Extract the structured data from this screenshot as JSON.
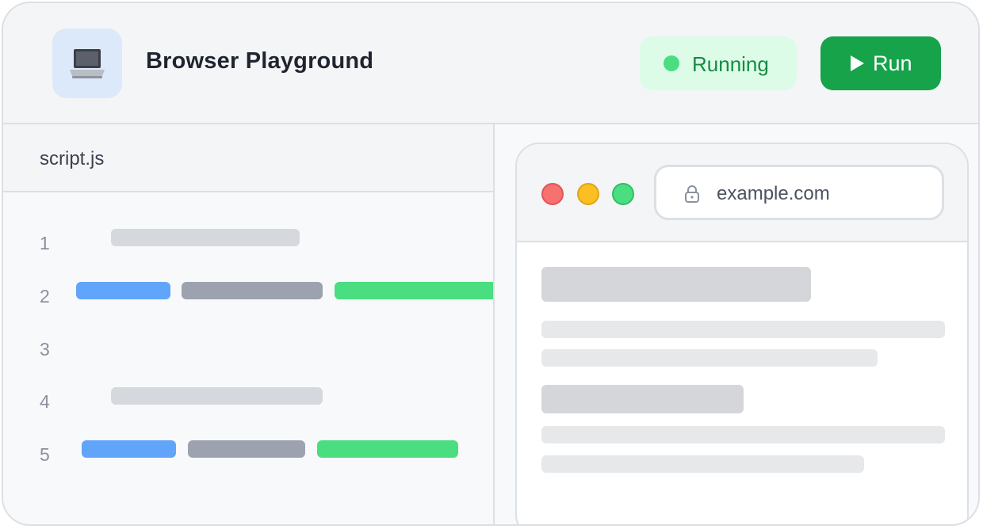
{
  "header": {
    "app_icon": "laptop-icon",
    "title": "Browser Playground",
    "status": {
      "label": "Running",
      "color": "#4ade80"
    },
    "run_button": {
      "icon": "play-icon",
      "label": "Run",
      "color": "#16a34a"
    }
  },
  "editor": {
    "tab": "script.js",
    "line_numbers": [
      "1",
      "2",
      "3",
      "4",
      "5"
    ],
    "token_colors": {
      "comment": "#d5d8dd",
      "keyword": "#60a5fa",
      "identifier": "#9ca3af",
      "string": "#4ade80"
    }
  },
  "browser": {
    "window_controls": [
      "close-dot",
      "minimize-dot",
      "maximize-dot"
    ],
    "address": {
      "icon": "lock-icon",
      "url": "example.com"
    }
  }
}
